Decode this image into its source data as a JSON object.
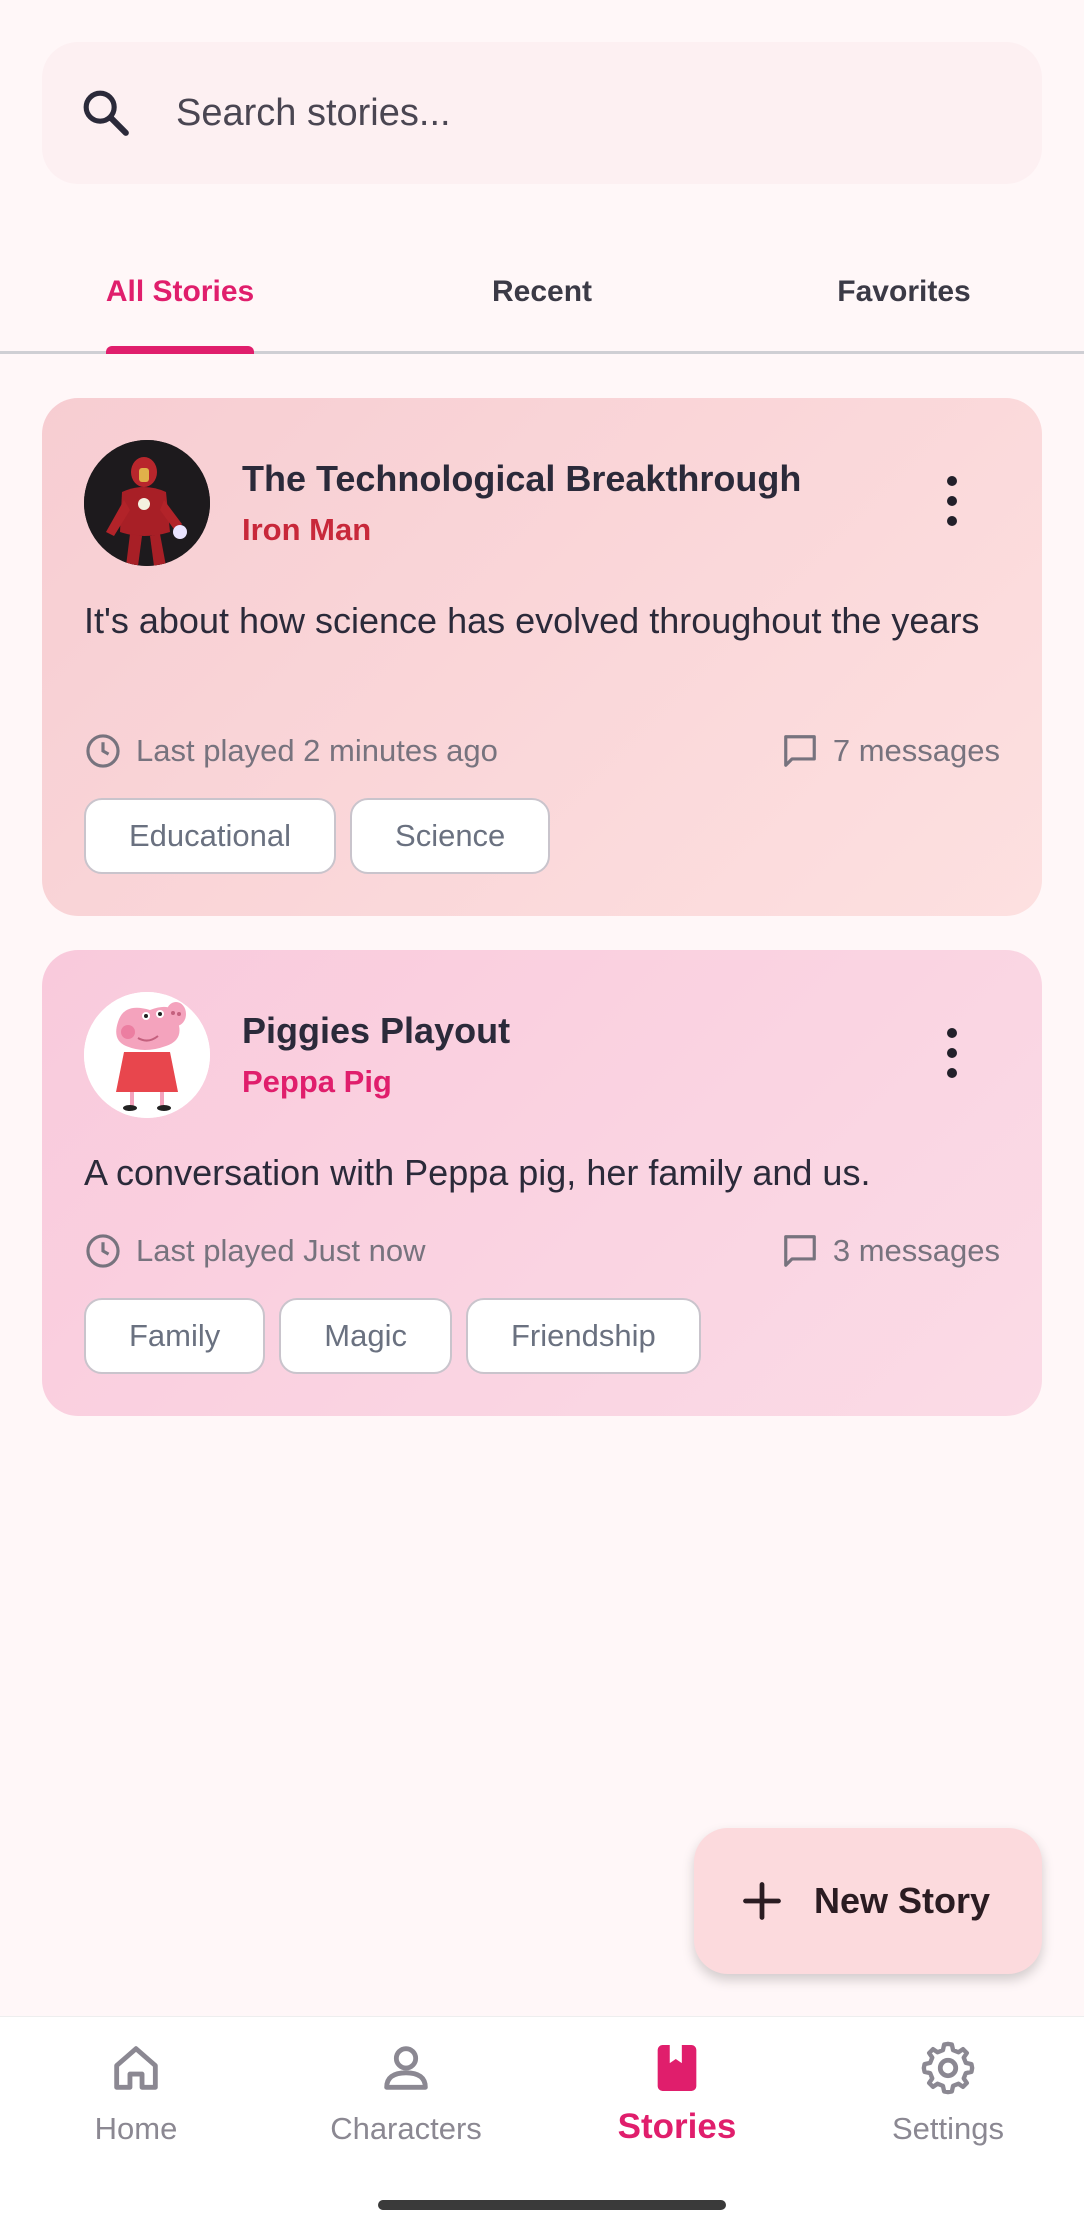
{
  "search": {
    "placeholder": "Search stories..."
  },
  "tabs": [
    {
      "label": "All Stories",
      "active": true
    },
    {
      "label": "Recent",
      "active": false
    },
    {
      "label": "Favorites",
      "active": false
    }
  ],
  "stories": [
    {
      "title": "The Technological Breakthrough",
      "character": "Iron Man",
      "character_color": "#c8283a",
      "description": "It's about how science has evolved throughout the years",
      "last_played": "Last played 2 minutes ago",
      "messages": "7 messages",
      "tags": [
        "Educational",
        "Science"
      ]
    },
    {
      "title": "Piggies Playout",
      "character": "Peppa Pig",
      "character_color": "#e01e6c",
      "description": "A conversation with Peppa pig, her family and us.",
      "last_played": "Last played Just now",
      "messages": "3 messages",
      "tags": [
        "Family",
        "Magic",
        "Friendship"
      ]
    }
  ],
  "fab": {
    "label": "New Story"
  },
  "nav": [
    {
      "label": "Home",
      "icon": "home-icon"
    },
    {
      "label": "Characters",
      "icon": "person-icon"
    },
    {
      "label": "Stories",
      "icon": "book-icon",
      "active": true
    },
    {
      "label": "Settings",
      "icon": "gear-icon"
    }
  ],
  "colors": {
    "accent": "#e01e6c",
    "background": "#fff7f8"
  }
}
